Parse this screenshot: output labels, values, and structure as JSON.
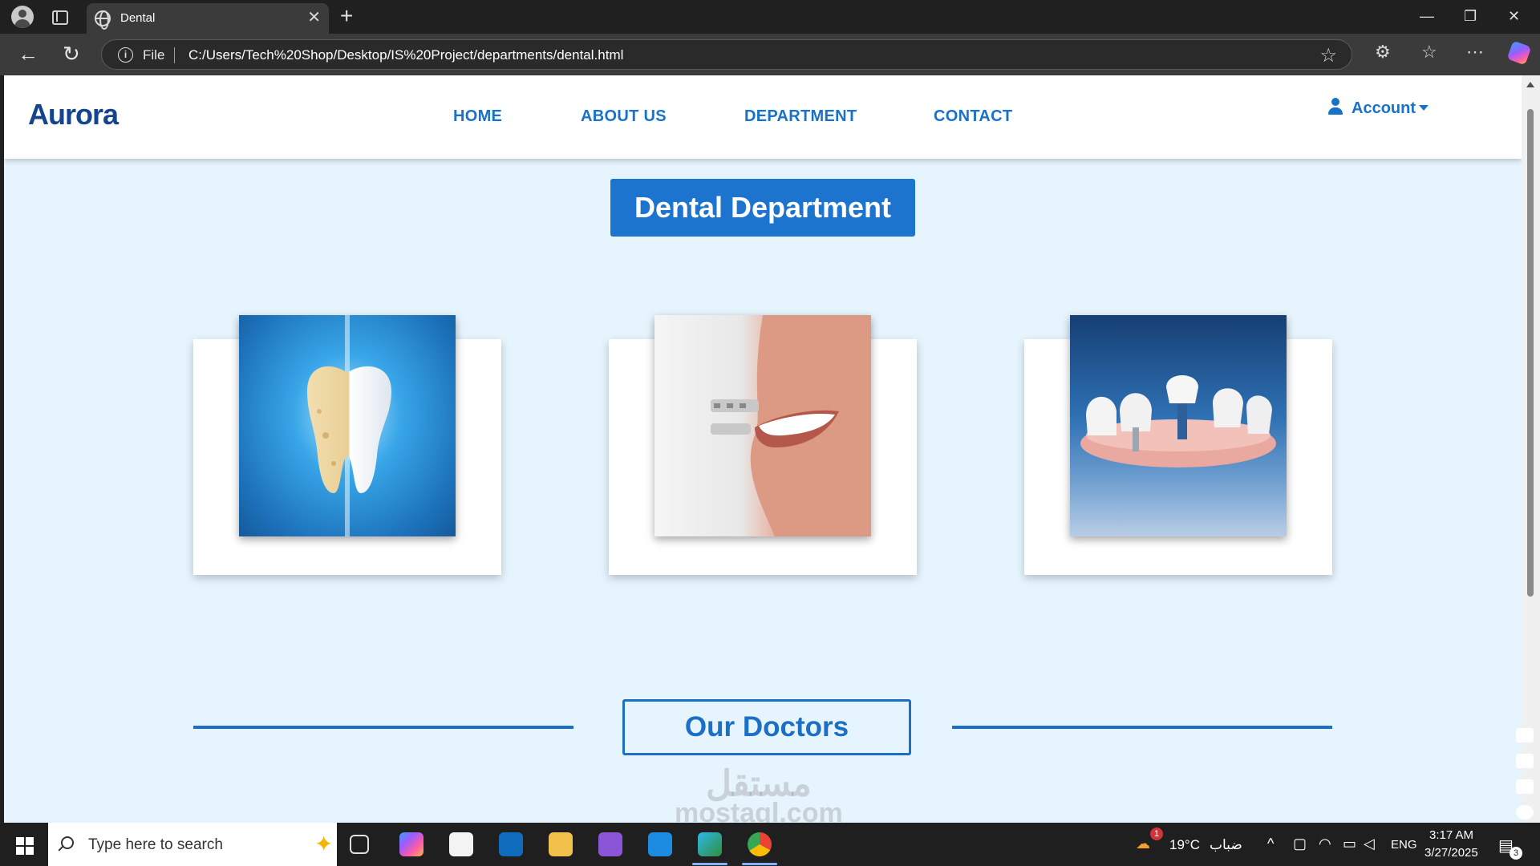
{
  "browser": {
    "tab_title": "Dental",
    "url_scheme_label": "File",
    "url": "C:/Users/Tech%20Shop/Desktop/IS%20Project/departments/dental.html"
  },
  "site": {
    "logo": "Aurora",
    "nav": [
      "HOME",
      "ABOUT US",
      "DEPARTMENT",
      "CONTACT"
    ],
    "account_label": "Account",
    "department_title": "Dental Department",
    "doctors_heading": "Our Doctors",
    "watermark_word": "مستقل",
    "watermark_url": "mostaql.com"
  },
  "department_cards": [
    {
      "image": "tooth-whitening-image"
    },
    {
      "image": "orthodontic-braces-smile-image"
    },
    {
      "image": "dental-implant-image"
    }
  ],
  "taskbar": {
    "search_placeholder": "Type here to search",
    "weather_temp": "19°C",
    "weather_desc": "ضباب",
    "weather_badge": "1",
    "language": "ENG",
    "time": "3:17 AM",
    "date": "3/27/2025",
    "notification_count": "3"
  },
  "colors": {
    "brand_blue": "#1c74cf",
    "nav_blue": "#1872c9",
    "logo_navy": "#13448c",
    "page_bg": "#e6f4fd"
  }
}
